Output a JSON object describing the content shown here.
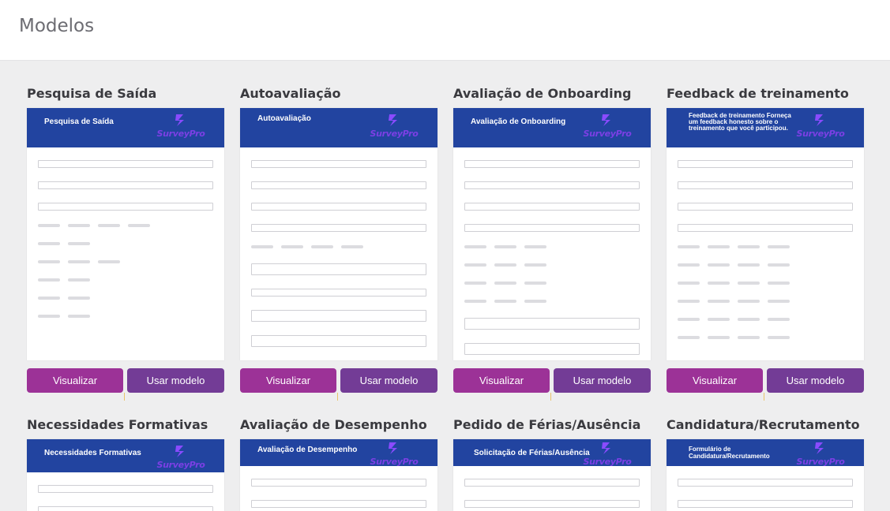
{
  "header": {
    "title": "Modelos"
  },
  "buttons": {
    "view": "Visualizar",
    "use": "Usar modelo"
  },
  "brand": {
    "logo_text": "SurveyPro",
    "logo_color": "#7b3fe4",
    "header_color": "#2244a0"
  },
  "colors": {
    "view_button": "#9c3297",
    "use_button": "#733c96"
  },
  "templates": [
    {
      "title": "Pesquisa de Saída",
      "form_header": "Pesquisa de Saída"
    },
    {
      "title": "Autoavaliação",
      "form_header": "Autoavaliação"
    },
    {
      "title": "Avaliação de Onboarding",
      "form_header": "Avaliação de Onboarding"
    },
    {
      "title": "Feedback de treinamento",
      "form_header": "Feedback de treinamento Forneça um feedback honesto sobre o treinamento que você participou."
    },
    {
      "title": "Necessidades Formativas",
      "form_header": "Necessidades Formativas"
    },
    {
      "title": "Avaliação de Desempenho",
      "form_header": "Avaliação de Desempenho"
    },
    {
      "title": "Pedido de Férias/Ausência",
      "form_header": "Solicitação de Férias/Ausência"
    },
    {
      "title": "Candidatura/Recrutamento",
      "form_header": "Formulário de Candidatura/Recrutamento"
    }
  ]
}
